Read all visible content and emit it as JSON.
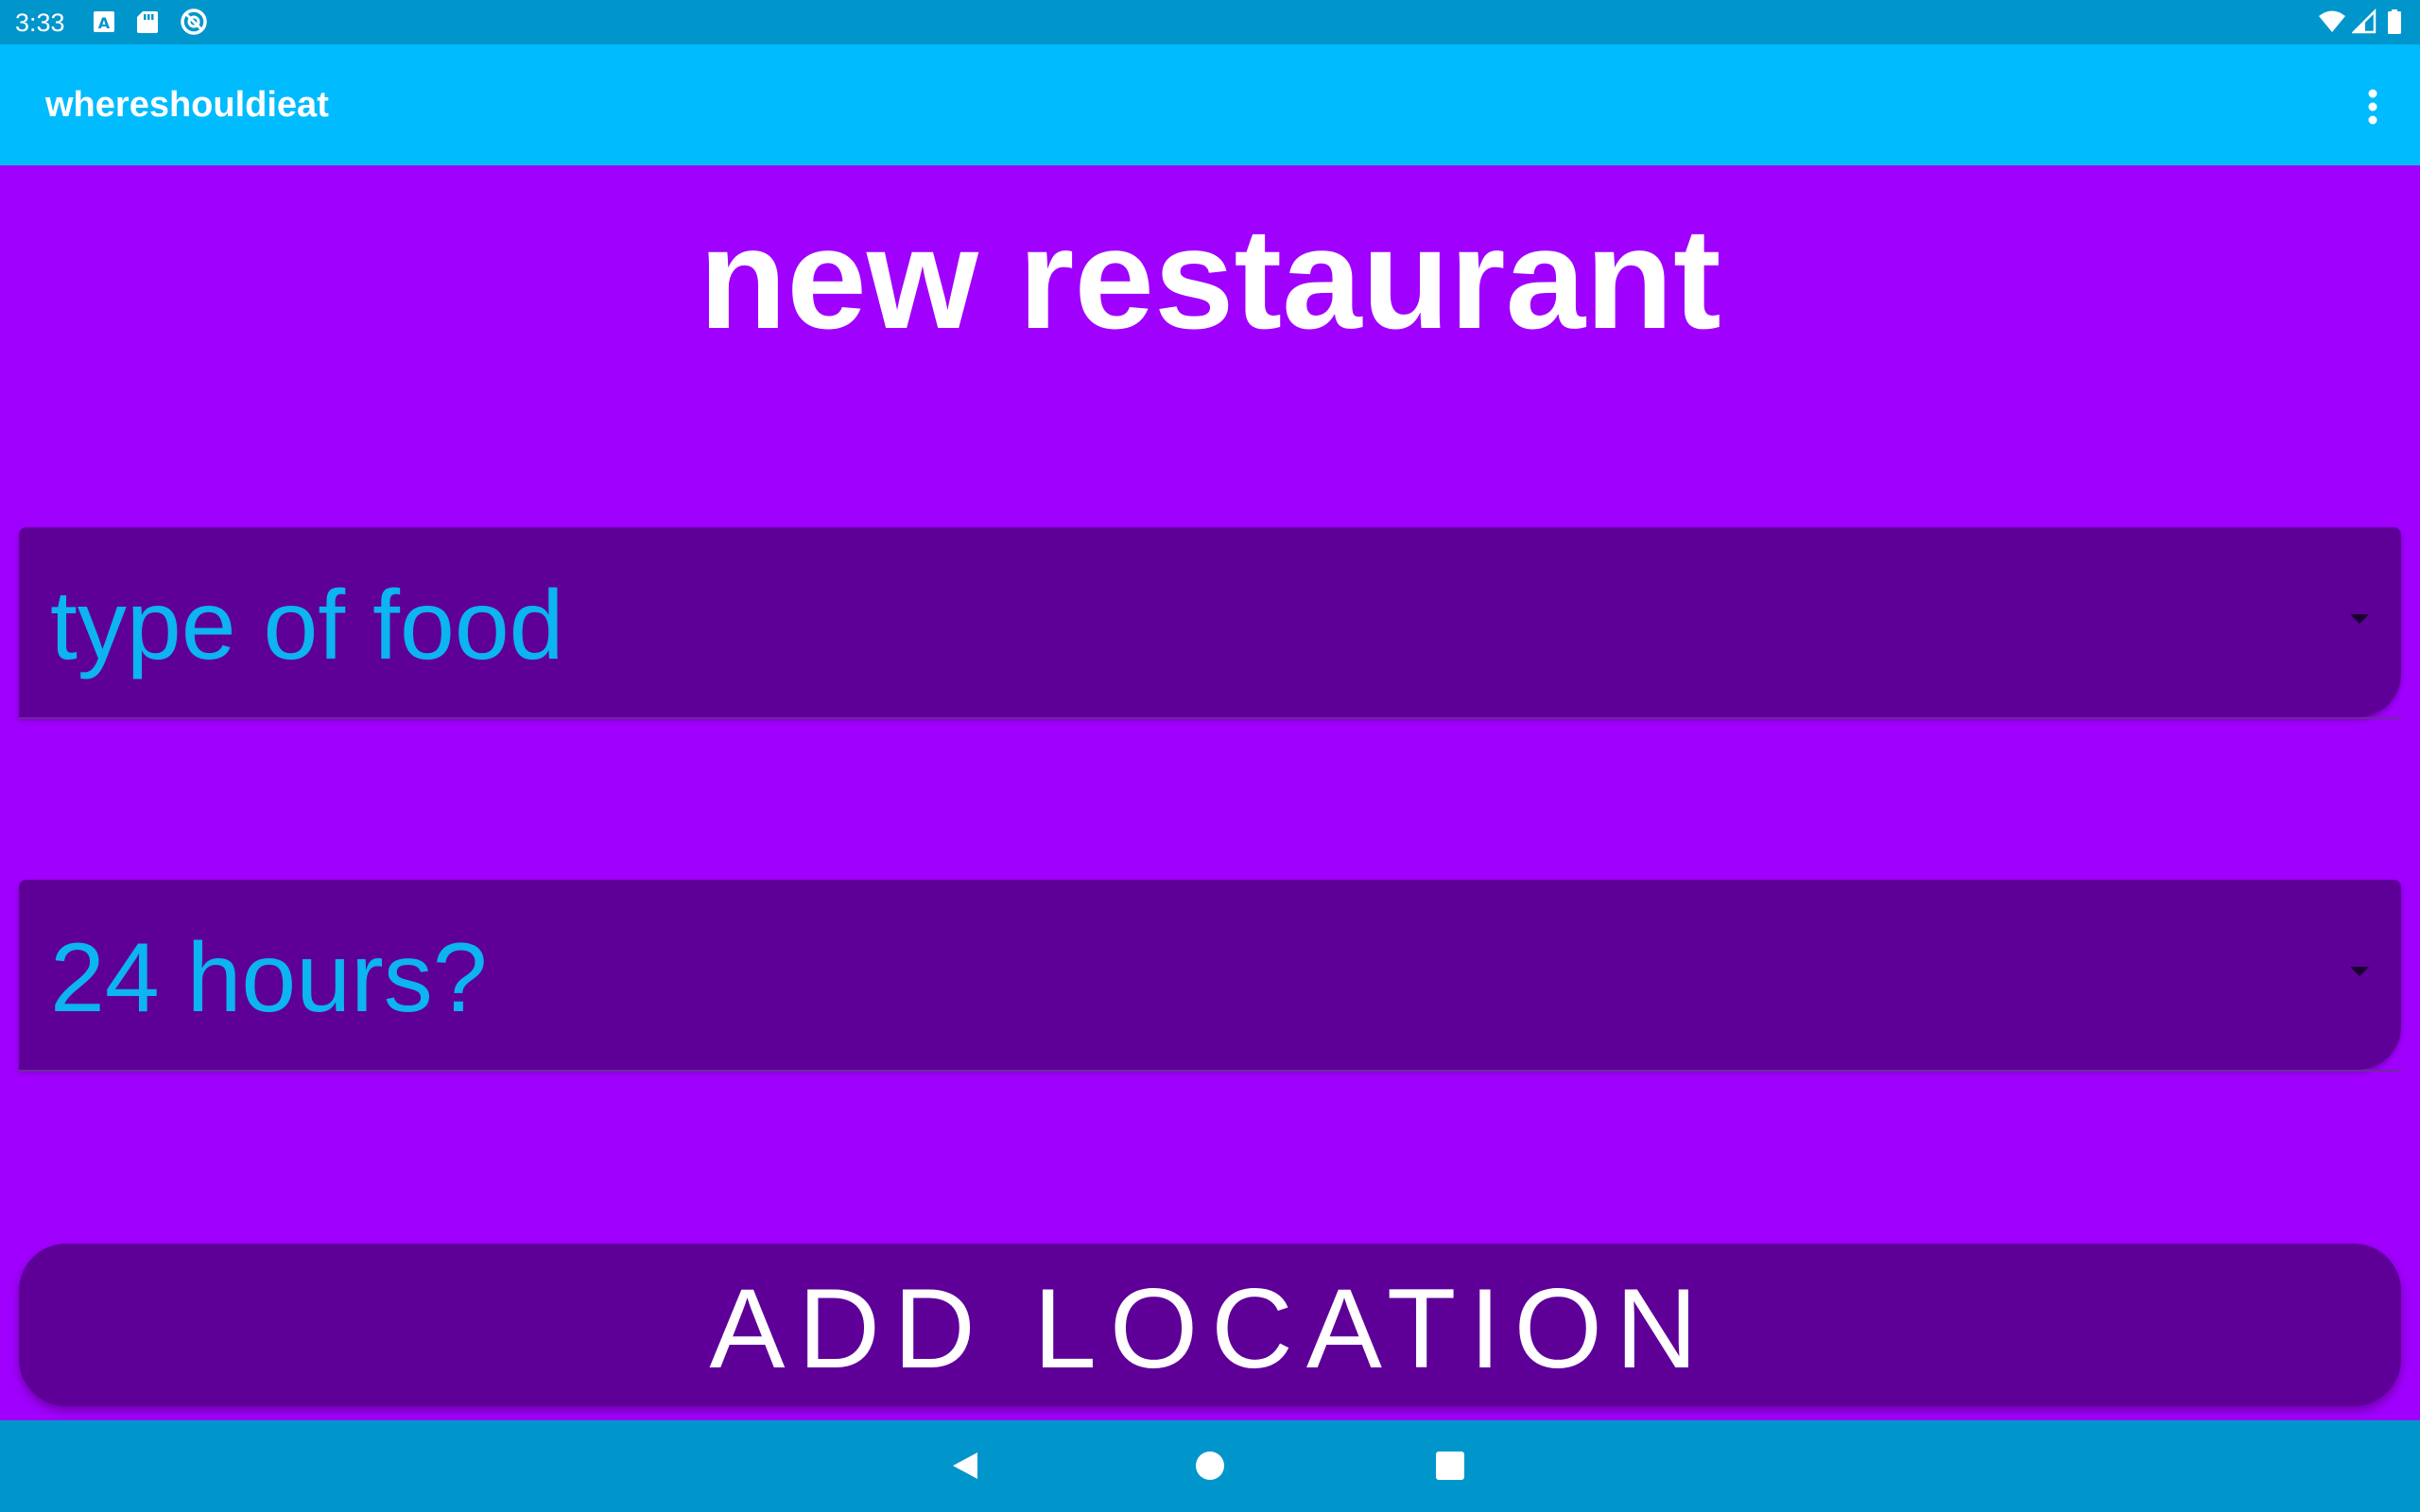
{
  "status_bar": {
    "time": "3:33",
    "left_icons": [
      "keyboard-a-icon",
      "sd-card-icon",
      "sync-icon"
    ],
    "right_icons": [
      "wifi-icon",
      "cell-signal-icon",
      "battery-icon"
    ]
  },
  "app_bar": {
    "title": "whereshouldieat",
    "menu_icon": "overflow-menu-icon"
  },
  "main": {
    "title": "new restaurant",
    "spinners": [
      {
        "value": "type of food",
        "icon": "dropdown-arrow-icon"
      },
      {
        "value": "24 hours?",
        "icon": "dropdown-arrow-icon"
      }
    ],
    "add_button_label": "ADD LOCATION"
  },
  "nav_bar": {
    "buttons": [
      "back-icon",
      "home-icon",
      "recents-icon"
    ]
  },
  "colors": {
    "background": "#a000fd",
    "status_bar": "#0096cc",
    "app_bar": "#00bbfd",
    "spinner": "#5e0097",
    "spinner_text": "#0cb4f0",
    "button_text": "#ffffff"
  }
}
